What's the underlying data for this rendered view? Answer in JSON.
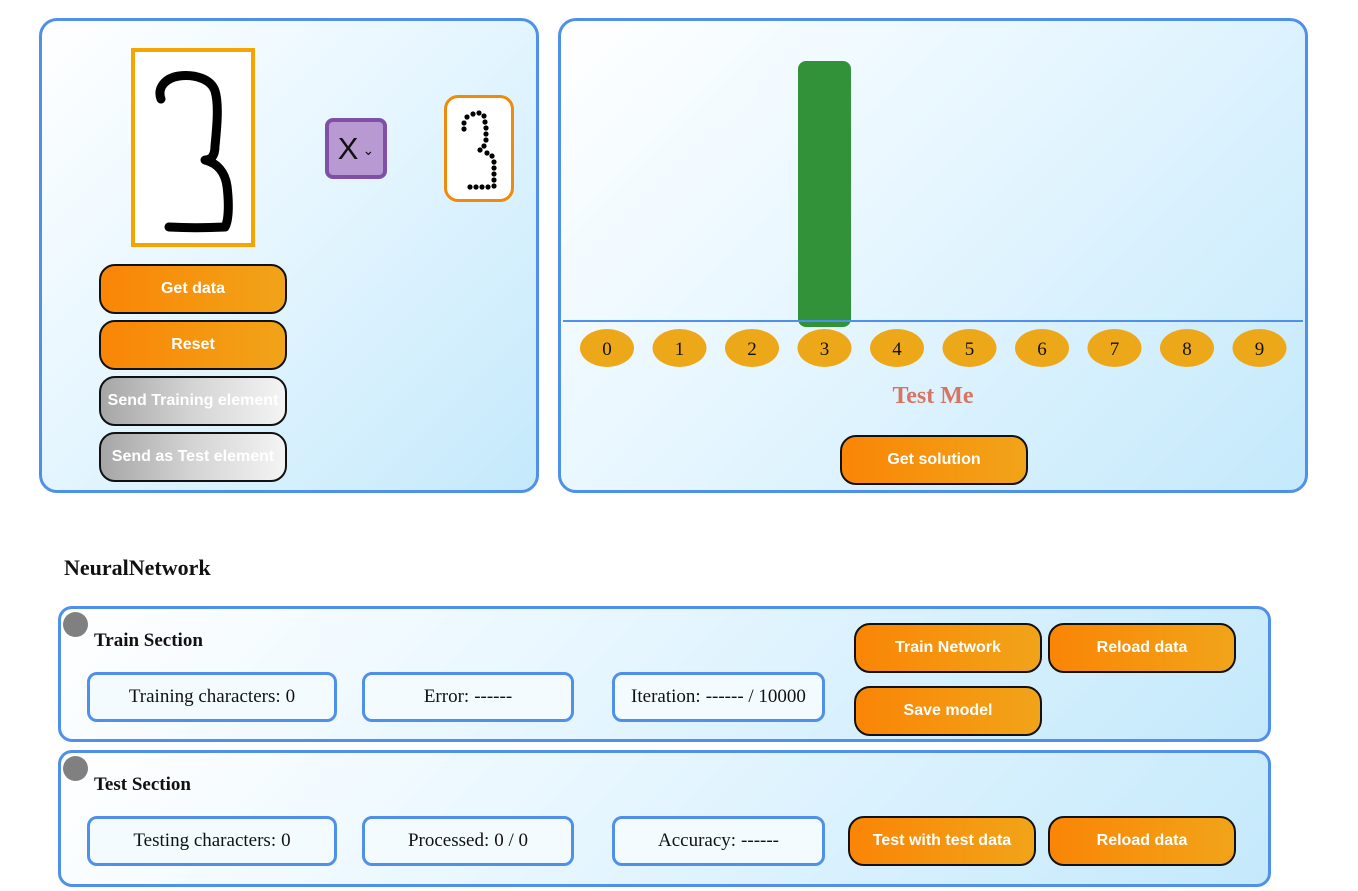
{
  "draw": {
    "clear_select_value": "X",
    "buttons": {
      "get_data": "Get data",
      "reset": "Reset",
      "send_training": "Send Training element",
      "send_test": "Send as Test element"
    }
  },
  "result": {
    "title": "Test Me",
    "get_solution": "Get solution",
    "chart_data": {
      "type": "bar",
      "categories": [
        "0",
        "1",
        "2",
        "3",
        "4",
        "5",
        "6",
        "7",
        "8",
        "9"
      ],
      "values": [
        0,
        0,
        0,
        1,
        0,
        0,
        0,
        0,
        0,
        0
      ],
      "ylim": [
        0,
        1
      ],
      "bar_color": "#31923a",
      "label_bubble_color": "#eda81a"
    }
  },
  "network": {
    "title": "NeuralNetwork",
    "train": {
      "title": "Train Section",
      "training_characters_label": "Training characters:",
      "training_characters_value": "0",
      "error_label": "Error:",
      "error_value": "------",
      "iteration_label": "Iteration:",
      "iteration_value": "------ / 10000",
      "buttons": {
        "train_network": "Train Network",
        "reload_data": "Reload data",
        "save_model": "Save model"
      }
    },
    "test": {
      "title": "Test Section",
      "testing_characters_label": "Testing characters:",
      "testing_characters_value": "0",
      "processed_label": "Processed:",
      "processed_value": "0 / 0",
      "accuracy_label": "Accuracy:",
      "accuracy_value": "------",
      "buttons": {
        "test_with_test_data": "Test with test data",
        "reload_data": "Reload data"
      }
    }
  },
  "colors": {
    "panel_border": "#4f90ea",
    "button_orange": "#fa8506",
    "status_dot": "#808080"
  }
}
